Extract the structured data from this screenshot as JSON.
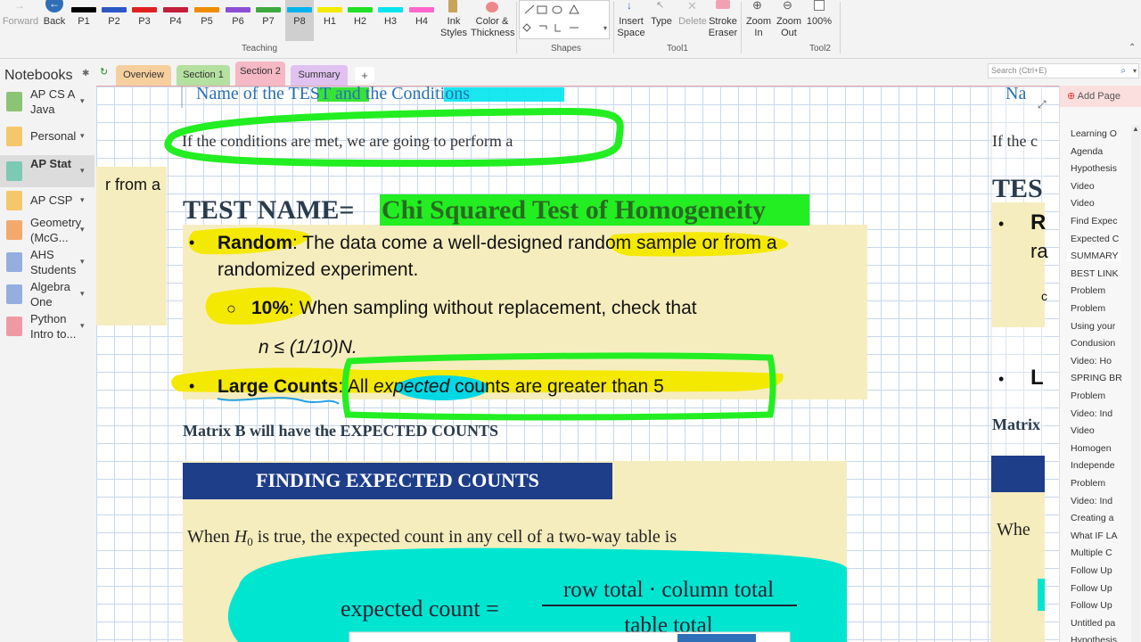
{
  "ribbon": {
    "forward_label": "Forward",
    "back_label": "Back",
    "pens": [
      {
        "label": "P1",
        "color": "#000000"
      },
      {
        "label": "P2",
        "color": "#2b57c7"
      },
      {
        "label": "P3",
        "color": "#e02020"
      },
      {
        "label": "P4",
        "color": "#c41e3a"
      },
      {
        "label": "P5",
        "color": "#f08c00"
      },
      {
        "label": "P6",
        "color": "#8a4fd6"
      },
      {
        "label": "P7",
        "color": "#3caa3c"
      },
      {
        "label": "P8",
        "color": "#00b2ee"
      },
      {
        "label": "H1",
        "color": "#f4e900"
      },
      {
        "label": "H2",
        "color": "#22e022"
      },
      {
        "label": "H3",
        "color": "#00e5ee"
      },
      {
        "label": "H4",
        "color": "#ff66cc"
      }
    ],
    "ink_styles_label": "Ink Styles",
    "color_thickness_label": "Color & Thickness",
    "teaching_group": "Teaching",
    "shapes_group": "Shapes",
    "insert_space_label": "Insert Space",
    "type_label": "Type",
    "delete_label": "Delete",
    "stroke_eraser_label": "Stroke Eraser",
    "tool1_group": "Tool1",
    "zoom_in_label": "Zoom In",
    "zoom_out_label": "Zoom Out",
    "zoom_level": "100%",
    "tool2_group": "Tool2"
  },
  "tabs": {
    "notebooks_label": "Notebooks",
    "sections": [
      {
        "label": "Overview",
        "color": "#f6cf9e"
      },
      {
        "label": "Section 1",
        "color": "#b4e0a0"
      },
      {
        "label": "Section 2",
        "color": "#f5b8c4"
      },
      {
        "label": "Summary",
        "color": "#e0c2f0"
      }
    ],
    "add_label": "+",
    "search_placeholder": "Search (Ctrl+E)"
  },
  "notebooks": [
    {
      "name": "AP CS A Java",
      "color": "#8bc474"
    },
    {
      "name": "Personal",
      "color": "#f4c86a"
    },
    {
      "name": "AP Stat",
      "color": "#7ec9b3"
    },
    {
      "name": "AP CSP",
      "color": "#f4c86a"
    },
    {
      "name": "Geometry (McG...",
      "color": "#f3a96c"
    },
    {
      "name": "AHS Students",
      "color": "#94aee0"
    },
    {
      "name": "Algebra One",
      "color": "#94aee0"
    },
    {
      "name": "Python Intro to...",
      "color": "#ef9aa3"
    }
  ],
  "note": {
    "top_heading": "Name of the TEST and the Conditions",
    "conditions_line": "If the conditions are met, we are going to perform a",
    "side_fragment": "r from a",
    "test_name_prefix": "TEST NAME= ",
    "test_name_value": "Chi Squared Test of Homogeneity",
    "random_label": "Random",
    "random_text_1": ": The data come a well-designed random sample or from a",
    "random_text_2": "randomized experiment.",
    "tenpct_bullet": "o",
    "tenpct_label": "10%",
    "tenpct_text": ": When sampling without replacement, check that",
    "tenpct_formula": "n ≤ (1/10)N.",
    "large_label": "Large Counts",
    "large_text_1": ": All ",
    "large_text_expected": "expected",
    "large_text_2": " counts are greater than 5",
    "matrix_line": "Matrix B will have the EXPECTED COUNTS",
    "banner_title": "FINDING EXPECTED COUNTS",
    "expected_intro_1": "When ",
    "expected_intro_h0": "H",
    "expected_intro_sub": "0",
    "expected_intro_2": " is true, the expected count in any cell of a two-way table is",
    "formula_lhs": "expected count =",
    "formula_num": "row total · column total",
    "formula_den": "table total",
    "bullet": "•",
    "bullet_hollow": "○"
  },
  "second_page": {
    "heading_frag": "Na",
    "cond_frag": "If the c",
    "test_frag": "TES",
    "r_frag": "R",
    "ra_frag": "ra",
    "l_frag": "L",
    "matrix_frag": "Matrix",
    "when_frag": "Whe",
    "c_frag": "c",
    "bullet": "•"
  },
  "pages": {
    "add_label": "Add Page",
    "items": [
      "Learning O",
      "Agenda",
      "Hypothesis",
      "Video",
      "Video",
      "Find Expec",
      "Expected C",
      "SUMMARY",
      "BEST LINK",
      "Problem",
      "Problem",
      "Using your",
      "Condusion",
      "Video: Ho",
      "SPRING BR",
      "Problem",
      "Video: Ind",
      "Video",
      "Homogen",
      "Independe",
      "Problem",
      "Video: Ind",
      "Creating a",
      "What IF LA",
      "Multiple C",
      "Follow Up",
      "Follow Up",
      "Follow Up",
      "Untitled pa",
      "Hypothesis"
    ],
    "selected_index": 7
  }
}
